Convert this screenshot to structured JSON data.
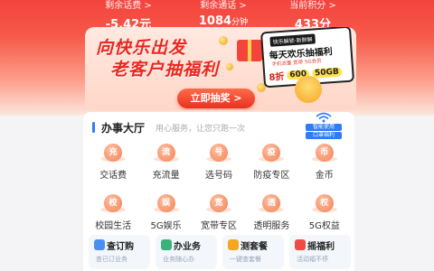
{
  "stats": [
    {
      "label": "剩余话费 >",
      "value": "-5.42元",
      "unit": ""
    },
    {
      "label": "剩余通话 >",
      "value": "1084",
      "unit": "分钟"
    },
    {
      "label": "当前积分 >",
      "value": "433分",
      "unit": ""
    }
  ],
  "banner": {
    "title_line1": "向快乐出发",
    "title_line2": "老客户抽福利",
    "promo_tag": "快乐解锁·新鲜解",
    "promo_headline": "每天欢乐抽福利",
    "promo_line": "手机流量 宽带 5G会员",
    "badge_discount": "8折",
    "badge_amount": "600",
    "badge_data": "50GB",
    "cta_label": "立即抽奖 >"
  },
  "hall": {
    "title": "办事大厅",
    "subtitle": "用心服务，让您只跑一次",
    "badge_line1": "智能使用",
    "badge_line2": "口罩福利",
    "services": [
      {
        "label": "交话费",
        "glyph": "充"
      },
      {
        "label": "充流量",
        "glyph": "流"
      },
      {
        "label": "选号码",
        "glyph": "号"
      },
      {
        "label": "防疫专区",
        "glyph": "疫"
      },
      {
        "label": "金币",
        "glyph": "币"
      },
      {
        "label": "校园生活",
        "glyph": "校"
      },
      {
        "label": "5G娱乐",
        "glyph": "娱"
      },
      {
        "label": "宽带专区",
        "glyph": "宽"
      },
      {
        "label": "透明服务",
        "glyph": "透"
      },
      {
        "label": "5G权益",
        "glyph": "权"
      }
    ],
    "quick": [
      {
        "title": "查订购",
        "sub": "查已订业务",
        "accent": "#4a90f0"
      },
      {
        "title": "办业务",
        "sub": "业务随心办",
        "accent": "#3bb27c"
      },
      {
        "title": "测套餐",
        "sub": "一键查套餐",
        "accent": "#f5a623"
      },
      {
        "title": "摇福利",
        "sub": "活动福不停",
        "accent": "#ef4b44"
      }
    ]
  }
}
